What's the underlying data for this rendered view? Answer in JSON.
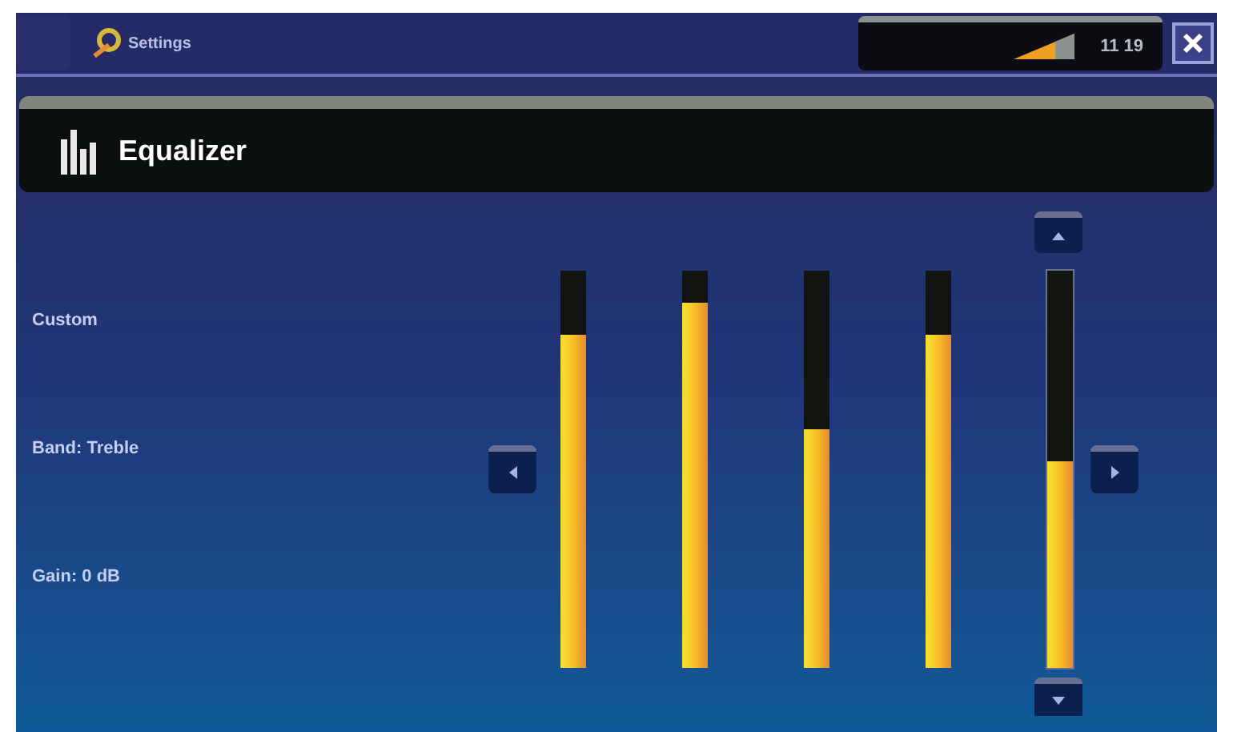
{
  "window": {
    "title": "Settings"
  },
  "status": {
    "time": "11 19"
  },
  "header": {
    "title": "Equalizer"
  },
  "info": [
    "Custom",
    "Band: Treble",
    "Gain: 0 dB"
  ],
  "bands": [
    {
      "level": 0.84,
      "selected": false
    },
    {
      "level": 0.92,
      "selected": false
    },
    {
      "level": 0.6,
      "selected": false
    },
    {
      "level": 0.84,
      "selected": false
    },
    {
      "level": 0.52,
      "selected": true
    }
  ]
}
